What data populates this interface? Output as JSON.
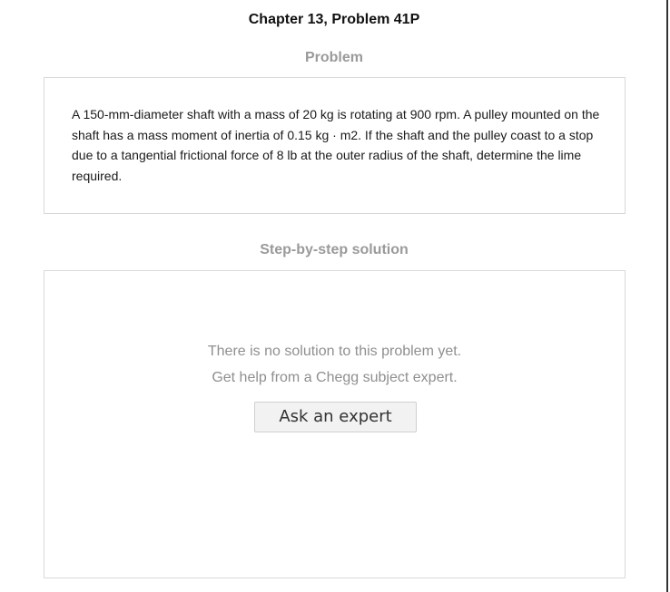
{
  "header": {
    "title": "Chapter 13, Problem 41P"
  },
  "problem": {
    "heading": "Problem",
    "text": "A 150-mm-diameter shaft with a mass of 20 kg is rotating at 900 rpm. A pulley mounted on the shaft has a mass moment of inertia of 0.15 kg · m2. If the shaft and the pulley coast to a stop due to a tangential frictional force of 8 lb at the outer radius of the shaft, determine the lime required."
  },
  "solution": {
    "heading": "Step-by-step solution",
    "message_line1": "There is no solution to this problem yet.",
    "message_line2": "Get help from a Chegg subject expert.",
    "ask_button_label": "Ask an expert"
  }
}
